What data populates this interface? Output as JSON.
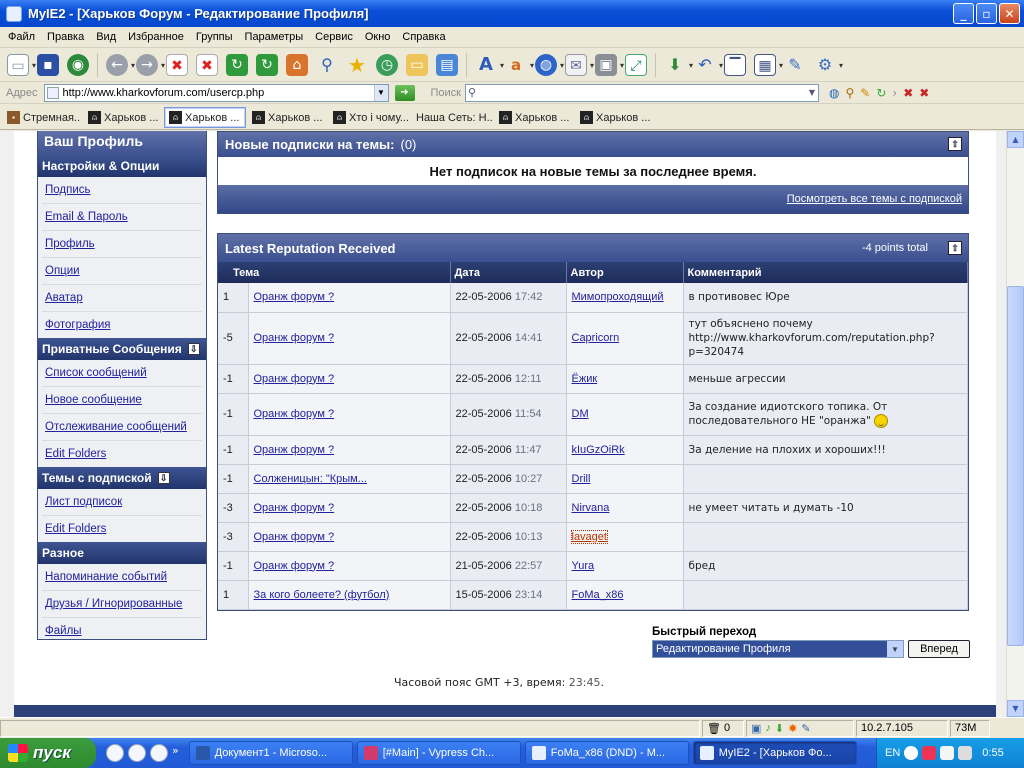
{
  "window": {
    "title": "MyIE2 - [Харьков Форум - Редактирование Профиля]",
    "controls": [
      "_",
      "▫",
      "✕"
    ]
  },
  "menu": [
    "Файл",
    "Правка",
    "Вид",
    "Избранное",
    "Группы",
    "Параметры",
    "Сервис",
    "Окно",
    "Справка"
  ],
  "toolbar_icons": [
    "new-page-icon",
    "save-icon",
    "globe-search-icon",
    "back-icon",
    "forward-icon",
    "stop-icon",
    "close-all-icon",
    "refresh-icon",
    "refresh-all-icon",
    "home-icon",
    "search-icon",
    "favorites-star-icon",
    "history-icon",
    "folder-icon",
    "page-icon",
    "font-size-icon",
    "translate-icon",
    "internet-icon",
    "mail-icon",
    "proxy-icon",
    "fullscreen-icon",
    "download-icon",
    "undo-icon",
    "window-icon",
    "tile-icon",
    "edit-icon",
    "tools-icon"
  ],
  "address": {
    "label": "Адрес",
    "url": "http://www.kharkovforum.com/usercp.php",
    "search_label": "Поиск",
    "search_value": ""
  },
  "tabs": [
    {
      "label": "Стремная...",
      "active": false
    },
    {
      "label": "Харьков ...",
      "active": false
    },
    {
      "label": "Харьков ...",
      "active": true
    },
    {
      "label": "Харьков ...",
      "active": false
    },
    {
      "label": "Хто і чому...",
      "active": false
    },
    {
      "label": "Наша Сеть: Н...",
      "active": false
    },
    {
      "label": "Харьков ...",
      "active": false
    },
    {
      "label": "Харьков ...",
      "active": false
    }
  ],
  "sidebar": {
    "heading": "Ваш Профиль",
    "sections": [
      {
        "title": "Настройки & Опции",
        "collapsible": false,
        "items": [
          "Подпись",
          "Email & Пароль",
          "Профиль",
          "Опции",
          "Аватар",
          "Фотография"
        ]
      },
      {
        "title": "Приватные Сообщения",
        "collapsible": true,
        "items": [
          "Список сообщений",
          "Новое сообщение",
          "Отслеживание сообщений",
          "Edit Folders"
        ]
      },
      {
        "title": "Темы с подпиской",
        "collapsible": true,
        "items": [
          "Лист подписок",
          "Edit Folders"
        ]
      },
      {
        "title": "Разное",
        "collapsible": false,
        "items": [
          "Напоминание событий",
          "Друзья / Игнорированные",
          "Файлы"
        ]
      }
    ]
  },
  "subscriptions": {
    "title": "Новые подписки на темы:",
    "count": "(0)",
    "message": "Нет подписок на новые темы за последнее время.",
    "footer_link": "Посмотреть все темы с подпиской"
  },
  "reputation": {
    "title": "Latest Reputation Received",
    "total": "-4 points total",
    "columns": [
      "Тема",
      "Дата",
      "Автор",
      "Комментарий"
    ],
    "rows": [
      {
        "points": "1",
        "topic": "Оранж форум ?",
        "date": "22-05-2006",
        "time": "17:42",
        "author": "Мимопроходящий",
        "comment": "в противовес Юре",
        "highlight": false,
        "smiley": false
      },
      {
        "points": "-5",
        "topic": "Оранж форум ?",
        "date": "22-05-2006",
        "time": "14:41",
        "author": "Capricorn",
        "comment": "тут объяснено почему http://www.kharkovforum.com/reputation.php?p=320474",
        "highlight": false,
        "smiley": false
      },
      {
        "points": "-1",
        "topic": "Оранж форум ?",
        "date": "22-05-2006",
        "time": "12:11",
        "author": "Ёжик",
        "comment": "меньше агрессии",
        "highlight": false,
        "smiley": false
      },
      {
        "points": "-1",
        "topic": "Оранж форум ?",
        "date": "22-05-2006",
        "time": "11:54",
        "author": "DM",
        "comment": "За создание идиотского топика. От последовательного НЕ \"оранжа\"",
        "highlight": false,
        "smiley": true
      },
      {
        "points": "-1",
        "topic": "Оранж форум ?",
        "date": "22-05-2006",
        "time": "11:47",
        "author": "kIuGzOiRk",
        "comment": "За деление на плохих и хороших!!!",
        "highlight": false,
        "smiley": false
      },
      {
        "points": "-1",
        "topic": "Солженицын: \"Крым...",
        "date": "22-05-2006",
        "time": "10:27",
        "author": "Drill",
        "comment": "",
        "highlight": false,
        "smiley": false
      },
      {
        "points": "-3",
        "topic": "Оранж форум ?",
        "date": "22-05-2006",
        "time": "10:18",
        "author": "Nirvana",
        "comment": "не умеет читать и думать -10",
        "highlight": false,
        "smiley": false
      },
      {
        "points": "-3",
        "topic": "Оранж форум ?",
        "date": "22-05-2006",
        "time": "10:13",
        "author": "lavaget",
        "comment": "",
        "highlight": true,
        "smiley": false
      },
      {
        "points": "-1",
        "topic": "Оранж форум ?",
        "date": "21-05-2006",
        "time": "22:57",
        "author": "Yura",
        "comment": "бред",
        "highlight": false,
        "smiley": false
      },
      {
        "points": "1",
        "topic": "За кого болеете? (футбол)",
        "date": "15-05-2006",
        "time": "23:14",
        "author": "FoMa_x86",
        "comment": "",
        "highlight": false,
        "smiley": false
      }
    ]
  },
  "quick_jump": {
    "label": "Быстрый переход",
    "selected": "Редактирование Профиля",
    "button": "Вперед"
  },
  "timezone": {
    "text": "Часовой пояс GMT +3, время:",
    "time": "23:45",
    "suffix": "."
  },
  "status_bar": {
    "popups": "0",
    "ip": "10.2.7.105",
    "memory": "73M"
  },
  "taskbar": {
    "start": "пуск",
    "tasks": [
      {
        "label": "Документ1 - Microso...",
        "active": false
      },
      {
        "label": "[#Main] - Vypress Ch...",
        "active": false
      },
      {
        "label": "FoMa_x86 (DND) - M...",
        "active": false
      },
      {
        "label": "MyIE2 - [Харьков Фо...",
        "active": true
      }
    ],
    "lang": "EN",
    "clock": "0:55"
  },
  "colors": {
    "xp_blue": "#0a4fd6",
    "forum_header": "#3b4e8f",
    "link": "#22229c",
    "highlight_author": "#b83400"
  }
}
